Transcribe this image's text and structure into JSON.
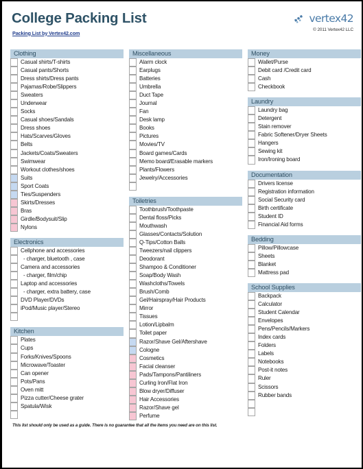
{
  "document": {
    "title": "College Packing List",
    "subtitle_link": "Packing List by Vertex42.com",
    "brand_name": "vertex42",
    "brand_mark_icon": "vertex42-logo-icon",
    "copyright": "© 2011 Vertex42 LLC",
    "footer_note": "This list should only be used as a guide.  There is no guarantee that all the items you need are on this list."
  },
  "colors": {
    "section_header_bg": "#b9cfdf",
    "section_header_text": "#2f4f63",
    "title_text": "#2e5266",
    "link_text": "#1f3c8c",
    "checkbox_border": "#a6a6a6",
    "checkbox_blue": "#c5d9f1",
    "checkbox_pink": "#f7c6d3",
    "page_background": "#ffffff"
  },
  "columns": [
    {
      "name": "left-column",
      "sections": [
        {
          "title": "Clothing",
          "items": [
            {
              "label": "Casual shirts/T-shirts",
              "box": "plain"
            },
            {
              "label": "Casual pants/Shorts",
              "box": "plain"
            },
            {
              "label": "Dress shirts/Dress pants",
              "box": "plain"
            },
            {
              "label": "Pajamas/Robe/Slippers",
              "box": "plain"
            },
            {
              "label": "Sweaters",
              "box": "plain"
            },
            {
              "label": "Underwear",
              "box": "plain"
            },
            {
              "label": "Socks",
              "box": "plain"
            },
            {
              "label": "Casual shoes/Sandals",
              "box": "plain"
            },
            {
              "label": "Dress shoes",
              "box": "plain"
            },
            {
              "label": "Hats/Scarves/Gloves",
              "box": "plain"
            },
            {
              "label": "Belts",
              "box": "plain"
            },
            {
              "label": "Jackets/Coats/Sweaters",
              "box": "plain"
            },
            {
              "label": "Swimwear",
              "box": "plain"
            },
            {
              "label": "Workout clothes/shoes",
              "box": "plain"
            },
            {
              "label": "Suits",
              "box": "blue"
            },
            {
              "label": "Sport Coats",
              "box": "blue"
            },
            {
              "label": "Ties/Suspenders",
              "box": "blue"
            },
            {
              "label": "Skirts/Dresses",
              "box": "pink"
            },
            {
              "label": "Bras",
              "box": "pink"
            },
            {
              "label": "Girdle/Bodysuit/Slip",
              "box": "pink"
            },
            {
              "label": "Nylons",
              "box": "pink"
            }
          ]
        },
        {
          "title": "Electronics",
          "items": [
            {
              "label": "Cellphone and accessories",
              "box": "plain"
            },
            {
              "label": "- charger, bluetooth , case",
              "box": "plain",
              "indent": true
            },
            {
              "label": "Camera and accessories",
              "box": "plain"
            },
            {
              "label": "- charger, film/chip",
              "box": "plain",
              "indent": true
            },
            {
              "label": "Laptop and accessories",
              "box": "plain"
            },
            {
              "label": "- charger, extra battery, case",
              "box": "plain",
              "indent": true
            },
            {
              "label": "DVD Player/DVDs",
              "box": "plain"
            },
            {
              "label": "iPod/Music player/Stereo",
              "box": "plain"
            },
            {
              "label": "",
              "box": "plain"
            }
          ]
        },
        {
          "title": "Kitchen",
          "items": [
            {
              "label": "Plates",
              "box": "plain"
            },
            {
              "label": "Cups",
              "box": "plain"
            },
            {
              "label": "Forks/Knives/Spoons",
              "box": "plain"
            },
            {
              "label": "Microwave/Toaster",
              "box": "plain"
            },
            {
              "label": "Can opener",
              "box": "plain"
            },
            {
              "label": "Pots/Pans",
              "box": "plain"
            },
            {
              "label": "Oven mitt",
              "box": "plain"
            },
            {
              "label": "Pizza cutter/Cheese grater",
              "box": "plain"
            },
            {
              "label": "Spatula/Wisk",
              "box": "plain"
            },
            {
              "label": "",
              "box": "plain"
            }
          ]
        }
      ]
    },
    {
      "name": "middle-column",
      "sections": [
        {
          "title": "Miscellaneous",
          "items": [
            {
              "label": "Alarm clock",
              "box": "plain"
            },
            {
              "label": "Earplugs",
              "box": "plain"
            },
            {
              "label": "Batteries",
              "box": "plain"
            },
            {
              "label": "Umbrella",
              "box": "plain"
            },
            {
              "label": "Duct Tape",
              "box": "plain"
            },
            {
              "label": "Journal",
              "box": "plain"
            },
            {
              "label": "Fan",
              "box": "plain"
            },
            {
              "label": "Desk lamp",
              "box": "plain"
            },
            {
              "label": "Books",
              "box": "plain"
            },
            {
              "label": "Pictures",
              "box": "plain"
            },
            {
              "label": "Movies/TV",
              "box": "plain"
            },
            {
              "label": "Board games/Cards",
              "box": "plain"
            },
            {
              "label": "Memo board/Erasable markers",
              "box": "plain"
            },
            {
              "label": "Plants/Flowers",
              "box": "plain"
            },
            {
              "label": "Jewelry/Accessories",
              "box": "plain"
            },
            {
              "label": "",
              "box": "plain"
            }
          ]
        },
        {
          "title": "Toiletries",
          "items": [
            {
              "label": "Toothbrush/Toothpaste",
              "box": "plain"
            },
            {
              "label": "Dental floss/Picks",
              "box": "plain"
            },
            {
              "label": "Mouthwash",
              "box": "plain"
            },
            {
              "label": "Glasses/Contacts/Solution",
              "box": "plain"
            },
            {
              "label": "Q-Tips/Cotton Balls",
              "box": "plain"
            },
            {
              "label": "Tweezers/nail clippers",
              "box": "plain"
            },
            {
              "label": "Deodorant",
              "box": "plain"
            },
            {
              "label": "Shampoo & Conditioner",
              "box": "plain"
            },
            {
              "label": "Soap/Body Wash",
              "box": "plain"
            },
            {
              "label": "Washcloths/Towels",
              "box": "plain"
            },
            {
              "label": "Brush/Comb",
              "box": "plain"
            },
            {
              "label": "Gel/Hairspray/Hair Products",
              "box": "plain"
            },
            {
              "label": "Mirror",
              "box": "plain"
            },
            {
              "label": "Tissues",
              "box": "plain"
            },
            {
              "label": "Lotion/Lipbalm",
              "box": "plain"
            },
            {
              "label": "Toilet paper",
              "box": "plain"
            },
            {
              "label": "Razor/Shave Gel/Aftershave",
              "box": "blue"
            },
            {
              "label": "Cologne",
              "box": "blue"
            },
            {
              "label": "Cosmetics",
              "box": "pink"
            },
            {
              "label": "Facial cleanser",
              "box": "pink"
            },
            {
              "label": "Pads/Tampons/Pantiliners",
              "box": "pink"
            },
            {
              "label": "Curling Iron/Flat Iron",
              "box": "pink"
            },
            {
              "label": "Blow dryer/Diffuser",
              "box": "pink"
            },
            {
              "label": "Hair Accessories",
              "box": "pink"
            },
            {
              "label": "Razor/Shave gel",
              "box": "pink"
            },
            {
              "label": "Perfume",
              "box": "pink"
            }
          ]
        }
      ]
    },
    {
      "name": "right-column",
      "sections": [
        {
          "title": "Money",
          "items": [
            {
              "label": "Wallet/Purse",
              "box": "plain"
            },
            {
              "label": "Debit card /Credit card",
              "box": "plain"
            },
            {
              "label": "Cash",
              "box": "plain"
            },
            {
              "label": "Checkbook",
              "box": "plain"
            }
          ]
        },
        {
          "title": "Laundry",
          "items": [
            {
              "label": "Laundry bag",
              "box": "plain"
            },
            {
              "label": "Detergent",
              "box": "plain"
            },
            {
              "label": "Stain remover",
              "box": "plain"
            },
            {
              "label": "Fabric Softener/Dryer Sheets",
              "box": "plain"
            },
            {
              "label": "Hangers",
              "box": "plain"
            },
            {
              "label": "Sewing kit",
              "box": "plain"
            },
            {
              "label": "Iron/Ironing board",
              "box": "plain"
            }
          ]
        },
        {
          "title": "Documentation",
          "items": [
            {
              "label": "Drivers license",
              "box": "plain"
            },
            {
              "label": "Registration information",
              "box": "plain"
            },
            {
              "label": "Social Security card",
              "box": "plain"
            },
            {
              "label": "Birth certificate",
              "box": "plain"
            },
            {
              "label": "Student ID",
              "box": "plain"
            },
            {
              "label": "Financial Aid forms",
              "box": "plain"
            }
          ]
        },
        {
          "title": "Bedding",
          "items": [
            {
              "label": "Pillow/Pillowcase",
              "box": "plain"
            },
            {
              "label": "Sheets",
              "box": "plain"
            },
            {
              "label": "Blanket",
              "box": "plain"
            },
            {
              "label": "Mattress pad",
              "box": "plain"
            }
          ]
        },
        {
          "title": "School Supplies",
          "items": [
            {
              "label": "Backpack",
              "box": "plain"
            },
            {
              "label": "Calculator",
              "box": "plain"
            },
            {
              "label": "Student Calendar",
              "box": "plain"
            },
            {
              "label": "Envelopes",
              "box": "plain"
            },
            {
              "label": "Pens/Pencils/Markers",
              "box": "plain"
            },
            {
              "label": "Index cards",
              "box": "plain"
            },
            {
              "label": "Folders",
              "box": "plain"
            },
            {
              "label": "Labels",
              "box": "plain"
            },
            {
              "label": "Notebooks",
              "box": "plain"
            },
            {
              "label": "Post-it notes",
              "box": "plain"
            },
            {
              "label": "Ruler",
              "box": "plain"
            },
            {
              "label": "Scissors",
              "box": "plain"
            },
            {
              "label": "Rubber bands",
              "box": "plain"
            },
            {
              "label": "",
              "box": "plain"
            },
            {
              "label": "",
              "box": "plain"
            }
          ]
        }
      ]
    }
  ]
}
